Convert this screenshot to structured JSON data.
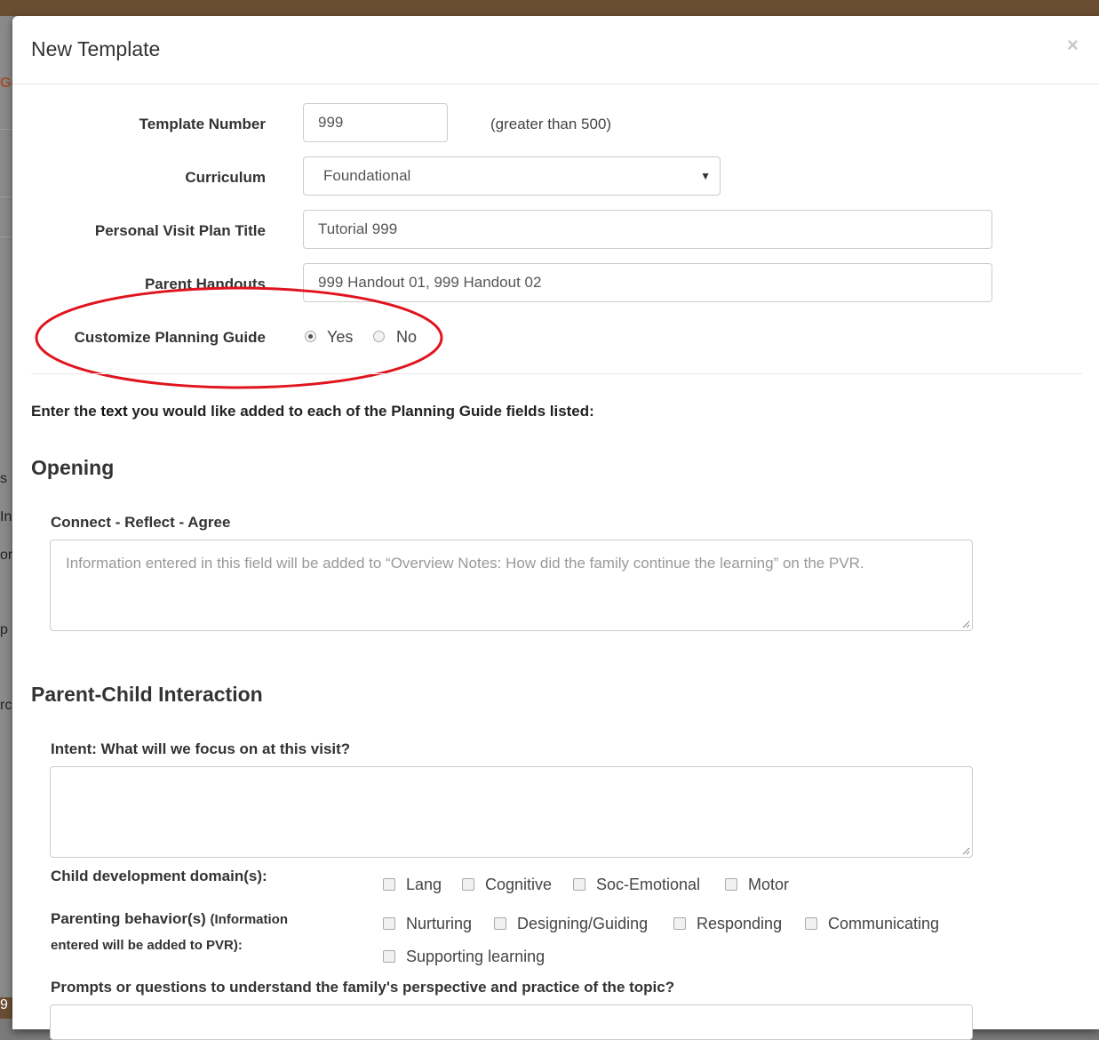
{
  "modal": {
    "title": "New Template",
    "close_glyph": "×"
  },
  "form": {
    "template_number": {
      "label": "Template Number",
      "value": "999",
      "hint": "(greater than 500)"
    },
    "curriculum": {
      "label": "Curriculum",
      "selected": "Foundational"
    },
    "pvp_title": {
      "label": "Personal Visit Plan Title",
      "value": "Tutorial 999"
    },
    "parent_handouts": {
      "label": "Parent Handouts",
      "value": "999 Handout 01, 999 Handout 02"
    },
    "customize_guide": {
      "label": "Customize Planning Guide",
      "options": [
        "Yes",
        "No"
      ],
      "selected": "Yes"
    }
  },
  "instruction": {
    "part1": "Enter the ",
    "part2": "text",
    "part3": " you would like added to each of the Planning Guide fields listed:"
  },
  "opening": {
    "title": "Opening",
    "crc_label": "Connect - Reflect - Agree",
    "crc_placeholder": "Information entered in this field will be added to “Overview Notes: How did the family continue the learning” on the PVR."
  },
  "pci": {
    "title": "Parent-Child Interaction",
    "intent_label": "Intent: What will we focus on at this visit?",
    "domains_label": "Child development domain(s):",
    "domains": [
      "Lang",
      "Cognitive",
      "Soc-Emotional",
      "Motor"
    ],
    "behaviors_label": "Parenting behavior(s)",
    "behaviors_note_a": "(Information",
    "behaviors_note_b": "entered will be added to PVR):",
    "behaviors": [
      "Nurturing",
      "Designing/Guiding",
      "Responding",
      "Communicating",
      "Supporting learning"
    ],
    "prompts_label": "Prompts or questions to understand the family's perspective and practice of the topic?"
  },
  "backdrop": {
    "fragments": [
      "Gu",
      "s",
      "In",
      "or",
      "p",
      "rc",
      "9"
    ]
  },
  "colors": {
    "annotation": "#e0141e",
    "header_bar": "#6b4e32"
  }
}
